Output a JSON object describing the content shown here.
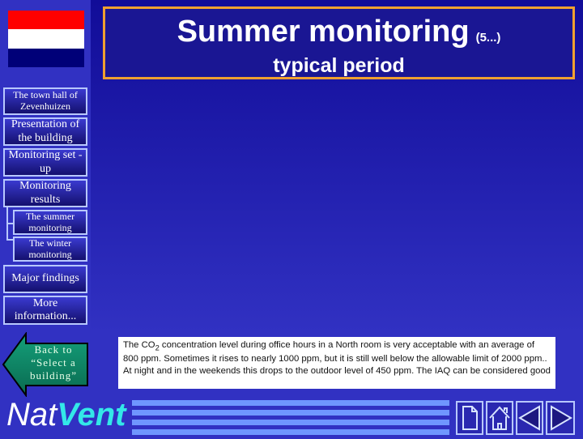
{
  "header": {
    "title": "Summer monitoring",
    "title_suffix": "(5...)",
    "subtitle": "typical period"
  },
  "flag": {
    "colors": [
      "#ff0000",
      "#ffffff",
      "#000078"
    ]
  },
  "sidebar": {
    "items": [
      {
        "label": "The town hall of Zevenhuizen"
      },
      {
        "label": "Presentation of the building"
      },
      {
        "label": "Monitoring set -up"
      },
      {
        "label": "Monitoring results"
      },
      {
        "label": "The summer monitoring"
      },
      {
        "label": "The winter monitoring"
      },
      {
        "label": "Major findings"
      },
      {
        "label": "More information..."
      }
    ]
  },
  "back_button": {
    "label": "Back to “Select a building”"
  },
  "description": {
    "text_before": "The CO",
    "subscript": "2",
    "text_after": " concentration level during office hours in a North room is very acceptable with an average of 800 ppm. Sometimes it rises to nearly 1000 ppm, but it is still well below the allowable limit of 2000 ppm.. At night and in the weekends this drops to the outdoor level of 450 ppm. The IAQ can be considered good"
  },
  "logo": {
    "part1": "Nat",
    "part2": "Vent"
  },
  "toolbar": {
    "icons": [
      "document-icon",
      "home-icon",
      "previous-icon",
      "next-icon"
    ]
  },
  "colors": {
    "accent_border": "#f0a030",
    "logo_accent": "#33e8e8",
    "back_button": "#0e8a6a"
  }
}
